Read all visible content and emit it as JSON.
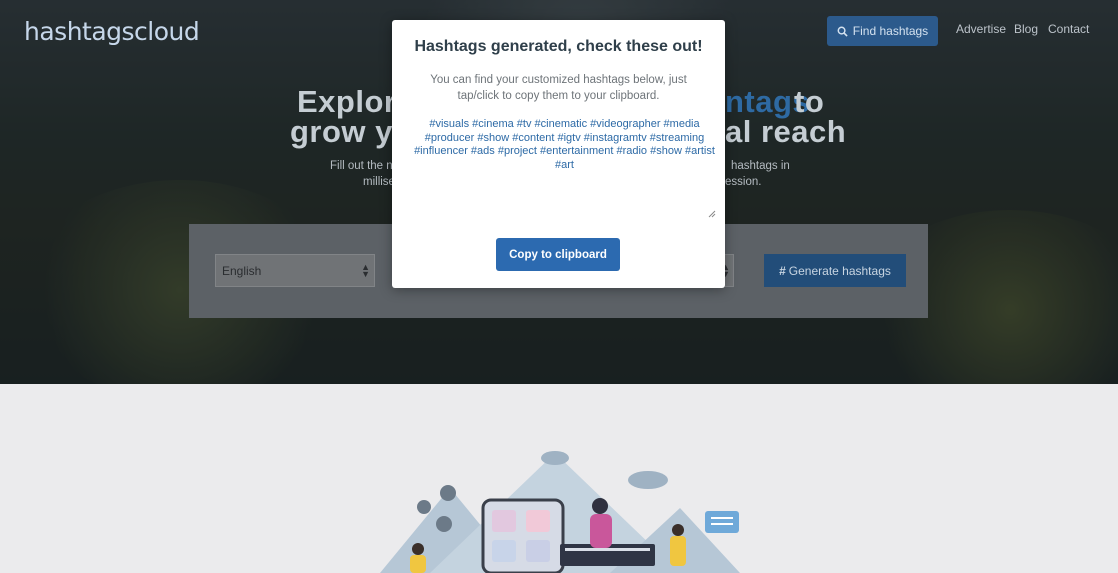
{
  "header": {
    "logo": "hashtagscloud",
    "find_button": "Find hashtags",
    "nav": [
      "Advertise",
      "Blog",
      "Contact"
    ]
  },
  "hero": {
    "title_line1_left": "Explore",
    "title_line1_accent": "ntags",
    "title_line1_right": "to",
    "title_line2_left": "grow yo",
    "title_line2_right": "al reach",
    "sub_left1": "Fill out the n",
    "sub_left2": "millise",
    "sub_right1": "hashtags in",
    "sub_right2": "ession."
  },
  "form": {
    "language_value": "English",
    "generate_button": "Generate hashtags"
  },
  "modal": {
    "title": "Hashtags generated, check these out!",
    "description": "You can find your customized hashtags below, just tap/click to copy them to your clipboard.",
    "hashtags": "#visuals #cinema #tv #cinematic #videographer #media #producer #show #content #igtv #instagramtv #streaming #influencer #ads #project #entertainment #radio #show #artist #art",
    "copy_button": "Copy to clipboard"
  },
  "colors": {
    "accent": "#2c6ab0",
    "hashtag_text": "#2d6aa6",
    "modal_title": "#2f3f4a"
  }
}
